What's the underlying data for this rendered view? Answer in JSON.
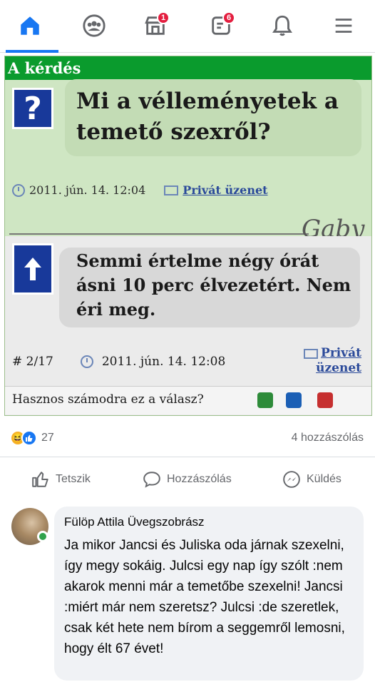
{
  "nav": {
    "items": [
      {
        "name": "home",
        "icon": "home-icon",
        "active": true
      },
      {
        "name": "groups",
        "icon": "groups-icon"
      },
      {
        "name": "marketplace",
        "icon": "marketplace-icon",
        "badge": "1"
      },
      {
        "name": "feeds",
        "icon": "feeds-icon",
        "badge": "6"
      },
      {
        "name": "notifications",
        "icon": "bell-icon"
      },
      {
        "name": "menu",
        "icon": "hamburger-icon"
      }
    ],
    "accent": "#1877f2"
  },
  "meme": {
    "header": "A kérdés",
    "question_mark": "?",
    "question": "Mi a vélleményetek a temető szexről?",
    "question_date": "2011. jún. 14. 12:04",
    "private_message": "Privát üzenet",
    "signature": "Gaby",
    "answer": "Semmi értelme négy órát ásni 10 perc élvezetért. Nem éri meg.",
    "answer_number": "# 2/17",
    "answer_date": "2011. jún. 14. 12:08",
    "answer_private_line1": "Privát",
    "answer_private_line2": "üzenet",
    "helpful_question": "Hasznos számodra ez a válasz?"
  },
  "post_stats": {
    "reaction_count": "27",
    "comment_count": "4 hozzászólás"
  },
  "actions": {
    "like": "Tetszik",
    "comment": "Hozzászólás",
    "send": "Küldés"
  },
  "comment": {
    "author": "Fülöp Attila Üvegszobrász",
    "text": "Ja mikor Jancsi és Juliska oda járnak szexelni, így megy sokáig. Julcsi egy nap így szólt :nem akarok menni már a temetőbe szexelni! Jancsi :miért már nem szeretsz? Julcsi :de szeretlek, csak két hete nem bírom a seggemről lemosni, hogy élt 67 évet!"
  }
}
